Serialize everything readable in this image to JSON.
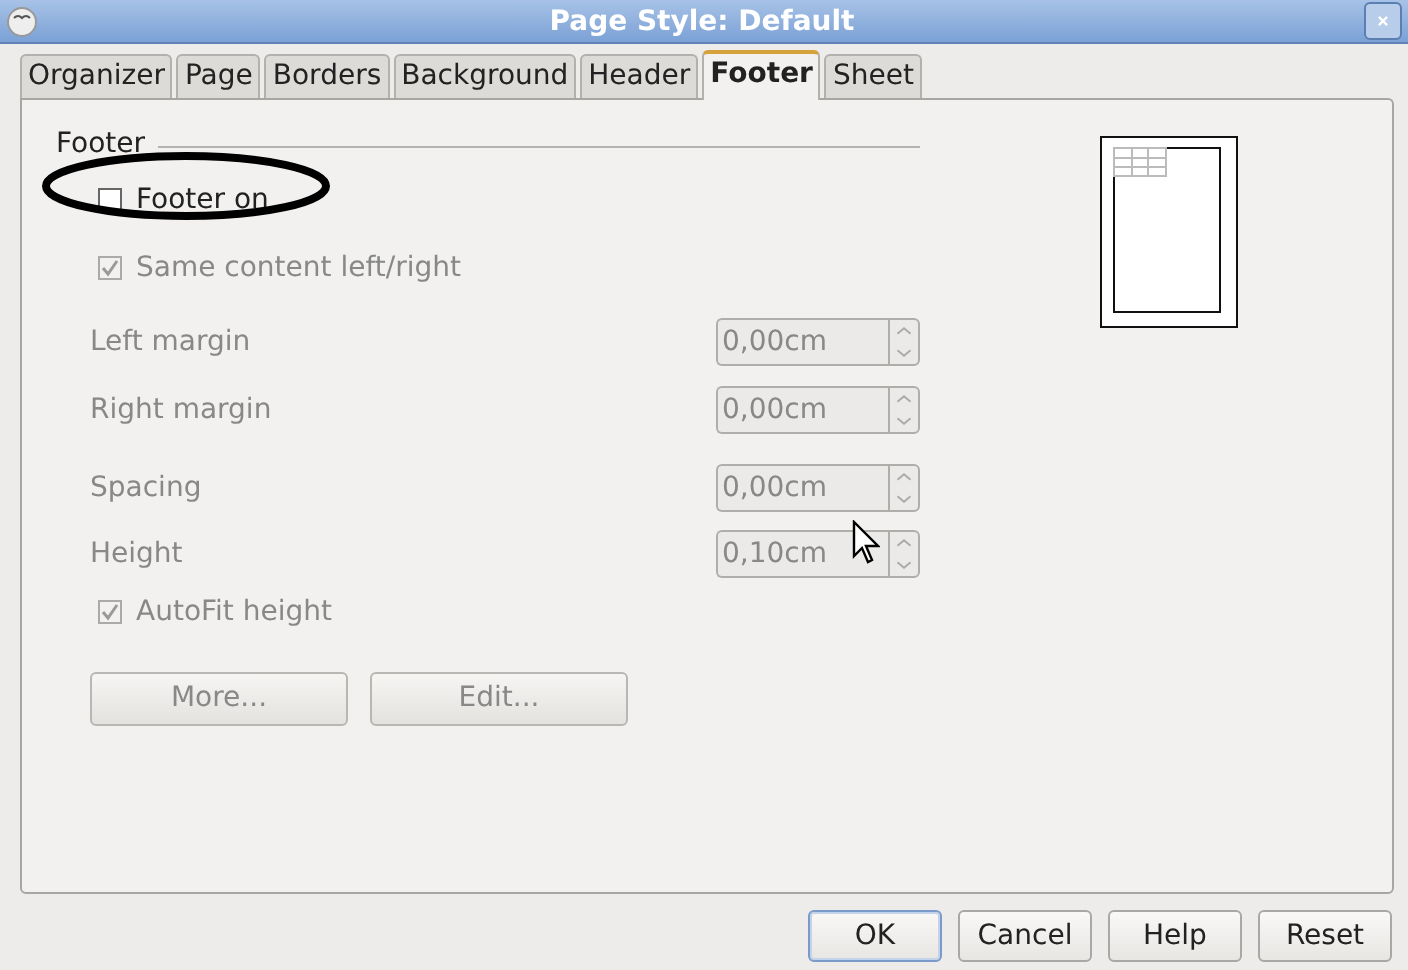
{
  "window": {
    "title": "Page Style: Default"
  },
  "tabs": [
    {
      "label": "Organizer",
      "selected": false
    },
    {
      "label": "Page",
      "selected": false
    },
    {
      "label": "Borders",
      "selected": false
    },
    {
      "label": "Background",
      "selected": false
    },
    {
      "label": "Header",
      "selected": false
    },
    {
      "label": "Footer",
      "selected": true
    },
    {
      "label": "Sheet",
      "selected": false
    }
  ],
  "section": {
    "title": "Footer"
  },
  "checkboxes": [
    {
      "label": "Footer on",
      "checked": false,
      "disabled": false
    },
    {
      "label": "Same content left/right",
      "checked": true,
      "disabled": true
    }
  ],
  "fields": [
    {
      "label": "Left margin",
      "value": "0,00cm",
      "disabled": true
    },
    {
      "label": "Right margin",
      "value": "0,00cm",
      "disabled": true
    },
    {
      "label": "Spacing",
      "value": "0,00cm",
      "disabled": true
    },
    {
      "label": "Height",
      "value": "0,10cm",
      "disabled": true
    }
  ],
  "autofit": {
    "label": "AutoFit height",
    "checked": true,
    "disabled": true
  },
  "panel_buttons": [
    {
      "label": "More...",
      "disabled": true
    },
    {
      "label": "Edit...",
      "disabled": true
    }
  ],
  "buttons": [
    {
      "label": "OK",
      "default": true
    },
    {
      "label": "Cancel",
      "default": false
    },
    {
      "label": "Help",
      "default": false
    },
    {
      "label": "Reset",
      "default": false
    }
  ]
}
